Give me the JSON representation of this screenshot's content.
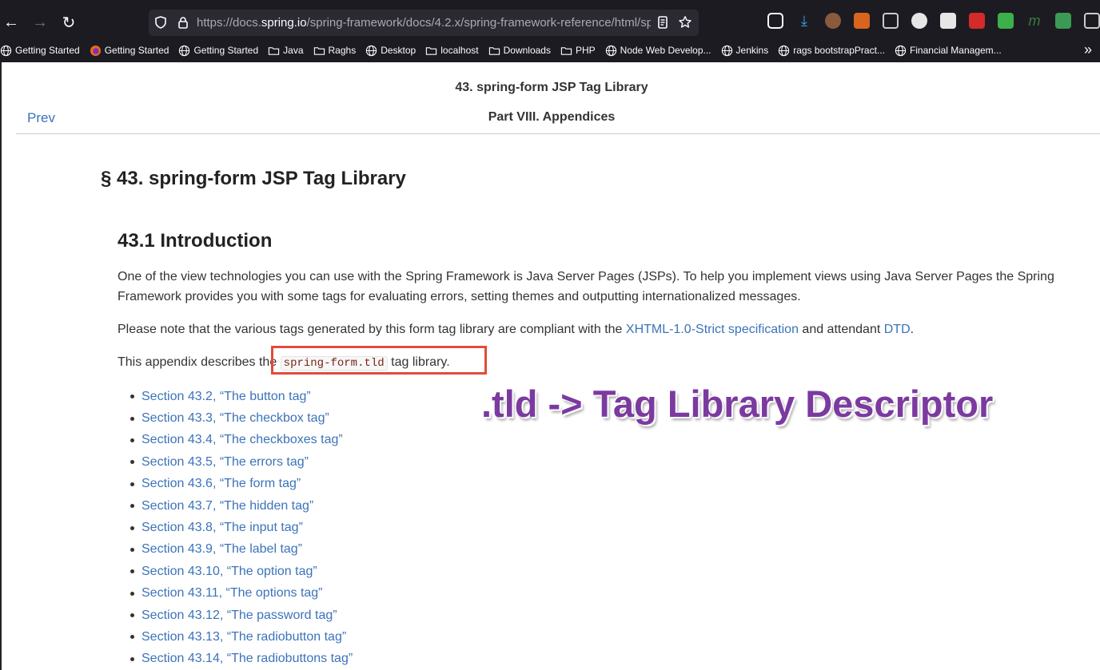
{
  "browser": {
    "url_prefix": "https://docs.",
    "url_domain": "spring.io",
    "url_path": "/spring-framework/docs/4.2.x/spring-framework-reference/html/sp",
    "bookmarks": [
      {
        "label": "Getting Started",
        "icon": "globe-icon"
      },
      {
        "label": "Getting Started",
        "icon": "firefox-icon"
      },
      {
        "label": "Getting Started",
        "icon": "globe-icon"
      },
      {
        "label": "Java",
        "icon": "folder-icon"
      },
      {
        "label": "Raghs",
        "icon": "folder-icon"
      },
      {
        "label": "Desktop",
        "icon": "globe-icon"
      },
      {
        "label": "localhost",
        "icon": "folder-icon"
      },
      {
        "label": "Downloads",
        "icon": "folder-icon"
      },
      {
        "label": "PHP",
        "icon": "folder-icon"
      },
      {
        "label": "Node Web Develop...",
        "icon": "globe-icon"
      },
      {
        "label": "Jenkins",
        "icon": "globe-icon"
      },
      {
        "label": "rags bootstrapPract...",
        "icon": "globe-icon"
      },
      {
        "label": "Financial Managem...",
        "icon": "globe-icon"
      }
    ],
    "colors": {
      "toolbar": "#1c1b22",
      "urlbar": "#2b2a33"
    }
  },
  "doc": {
    "nav_title": "43. spring-form JSP Tag Library",
    "prev": "Prev",
    "part_title": "Part VIII. Appendices",
    "chapter_title": "§ 43. spring-form JSP Tag Library",
    "section_title": "43.1 Introduction",
    "intro": "One of the view technologies you can use with the Spring Framework is Java Server Pages (JSPs). To help you implement views using Java Server Pages the Spring Framework provides you with some tags for evaluating errors, setting themes and outputting internationalized messages.",
    "note_before": "Please note that the various tags generated by this form tag library are compliant with the ",
    "note_link1": "XHTML-1.0-Strict specification",
    "note_middle": " and attendant ",
    "note_link2": "DTD",
    "note_after": ".",
    "appendix_before": "This appendix describes the ",
    "appendix_code": "spring-form.tld",
    "appendix_after": " tag library.",
    "toc": [
      "Section 43.2, “The button tag”",
      "Section 43.3, “The checkbox tag”",
      "Section 43.4, “The checkboxes tag”",
      "Section 43.5, “The errors tag”",
      "Section 43.6, “The form tag”",
      "Section 43.7, “The hidden tag”",
      "Section 43.8, “The input tag”",
      "Section 43.9, “The label tag”",
      "Section 43.10, “The option tag”",
      "Section 43.11, “The options tag”",
      "Section 43.12, “The password tag”",
      "Section 43.13, “The radiobutton tag”",
      "Section 43.14, “The radiobuttons tag”"
    ],
    "colors": {
      "link": "#3b73b9",
      "highlight_box": "#e24b3b"
    }
  },
  "annotation": {
    "text": ".tld -> Tag Library Descriptor",
    "color": "#7b3aa0"
  }
}
